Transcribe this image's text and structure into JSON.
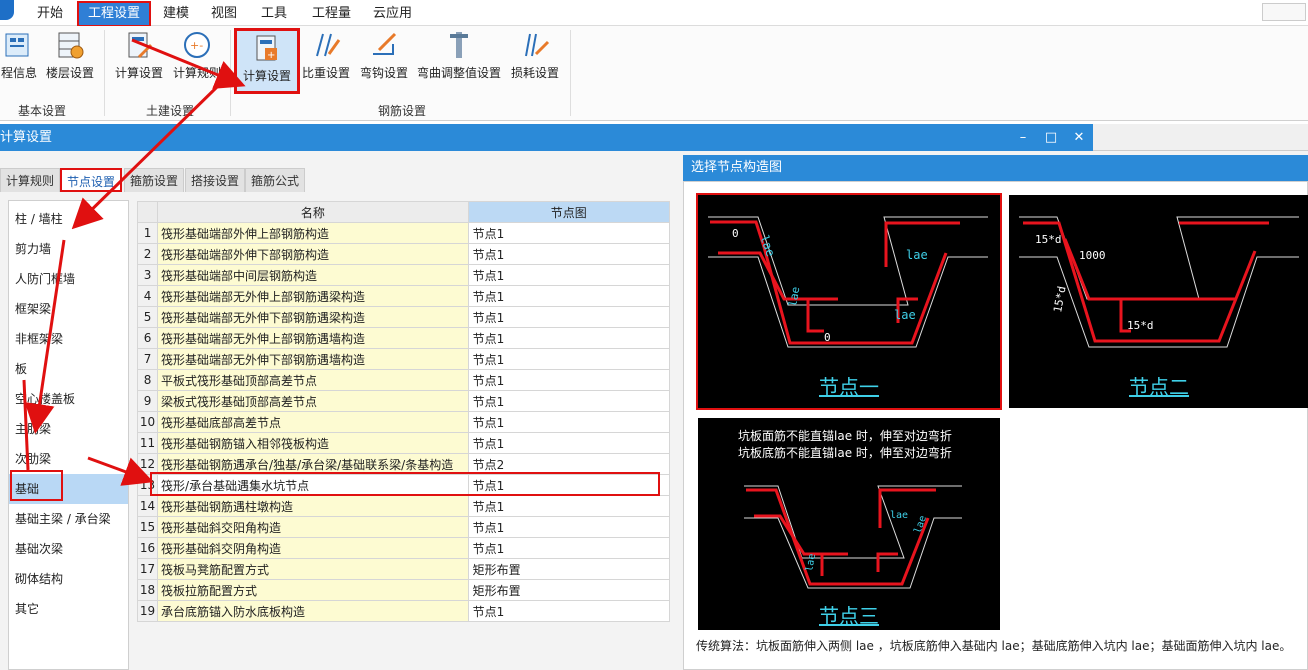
{
  "menubar": {
    "items": [
      "开始",
      "工程设置",
      "建模",
      "视图",
      "工具",
      "工程量",
      "云应用"
    ],
    "active": "工程设置"
  },
  "ribbon": {
    "groups": [
      {
        "label": "基本设置",
        "buttons": [
          "程信息",
          "楼层设置"
        ]
      },
      {
        "label": "土建设置",
        "buttons": [
          "计算设置",
          "计算规则"
        ]
      },
      {
        "label": "钢筋设置",
        "buttons": [
          "计算设置",
          "比重设置",
          "弯钩设置",
          "弯曲调整值设置",
          "损耗设置"
        ]
      }
    ],
    "selected_button": "钢筋设置 / 计算设置"
  },
  "dialog": {
    "title": "计算设置",
    "tabs": [
      "计算规则",
      "节点设置",
      "箍筋设置",
      "搭接设置",
      "箍筋公式"
    ],
    "active_tab": "节点设置"
  },
  "left_list": {
    "items": [
      "柱 / 墙柱",
      "剪力墙",
      "人防门框墙",
      "框架梁",
      "非框架梁",
      "板",
      "空心楼盖板",
      "主肋梁",
      "次肋梁",
      "基础",
      "基础主梁 / 承台梁",
      "基础次梁",
      "砌体结构",
      "其它"
    ],
    "selected": "基础"
  },
  "grid": {
    "headers": {
      "name": "名称",
      "node": "节点图"
    },
    "rows": [
      {
        "no": "1",
        "name": "筏形基础端部外伸上部钢筋构造",
        "node": "节点1"
      },
      {
        "no": "2",
        "name": "筏形基础端部外伸下部钢筋构造",
        "node": "节点1"
      },
      {
        "no": "3",
        "name": "筏形基础端部中间层钢筋构造",
        "node": "节点1"
      },
      {
        "no": "4",
        "name": "筏形基础端部无外伸上部钢筋遇梁构造",
        "node": "节点1"
      },
      {
        "no": "5",
        "name": "筏形基础端部无外伸下部钢筋遇梁构造",
        "node": "节点1"
      },
      {
        "no": "6",
        "name": "筏形基础端部无外伸上部钢筋遇墙构造",
        "node": "节点1"
      },
      {
        "no": "7",
        "name": "筏形基础端部无外伸下部钢筋遇墙构造",
        "node": "节点1"
      },
      {
        "no": "8",
        "name": "平板式筏形基础顶部高差节点",
        "node": "节点1"
      },
      {
        "no": "9",
        "name": "梁板式筏形基础顶部高差节点",
        "node": "节点1"
      },
      {
        "no": "10",
        "name": "筏形基础底部高差节点",
        "node": "节点1"
      },
      {
        "no": "11",
        "name": "筏形基础钢筋锚入相邻筏板构造",
        "node": "节点1"
      },
      {
        "no": "12",
        "name": "筏形基础钢筋遇承台/独基/承台梁/基础联系梁/条基构造",
        "node": "节点2"
      },
      {
        "no": "13",
        "name": "筏形/承台基础遇集水坑节点",
        "node": "节点1"
      },
      {
        "no": "14",
        "name": "筏形基础钢筋遇柱墩构造",
        "node": "节点1"
      },
      {
        "no": "15",
        "name": "筏形基础斜交阳角构造",
        "node": "节点1"
      },
      {
        "no": "16",
        "name": "筏形基础斜交阴角构造",
        "node": "节点1"
      },
      {
        "no": "17",
        "name": "筏板马凳筋配置方式",
        "node": "矩形布置"
      },
      {
        "no": "18",
        "name": "筏板拉筋配置方式",
        "node": "矩形布置"
      },
      {
        "no": "19",
        "name": "承台底筋锚入防水底板构造",
        "node": "节点1"
      }
    ],
    "selected_row": "13"
  },
  "node_panel": {
    "title": "选择节点构造图",
    "nodes": [
      {
        "caption": "节点一",
        "labels": [
          "lae",
          "lae",
          "lae",
          "lae"
        ]
      },
      {
        "caption": "节点二",
        "labels": [
          "15*d",
          "1000",
          "15*d",
          "15*d"
        ]
      },
      {
        "caption": "节点三",
        "lines": [
          "坑板面筋不能直锚lae 时，伸至对边弯折",
          "坑板底筋不能直锚lae 时，伸至对边弯折"
        ],
        "labels": [
          "lae",
          "lae",
          "lae"
        ]
      }
    ],
    "selected_node": "节点一",
    "footer": "传统算法：坑板面筋伸入两侧 lae ，坑板底筋伸入基础内 lae；基础底筋伸入坑内 lae；基础面筋伸入坑内 lae。"
  },
  "colors": {
    "accent": "#2b8ad8",
    "highlight": "#e01010",
    "cell_yellow": "#fdfbd2",
    "diagram_red": "#e8141e",
    "diagram_cyan": "#3fd0e8"
  }
}
